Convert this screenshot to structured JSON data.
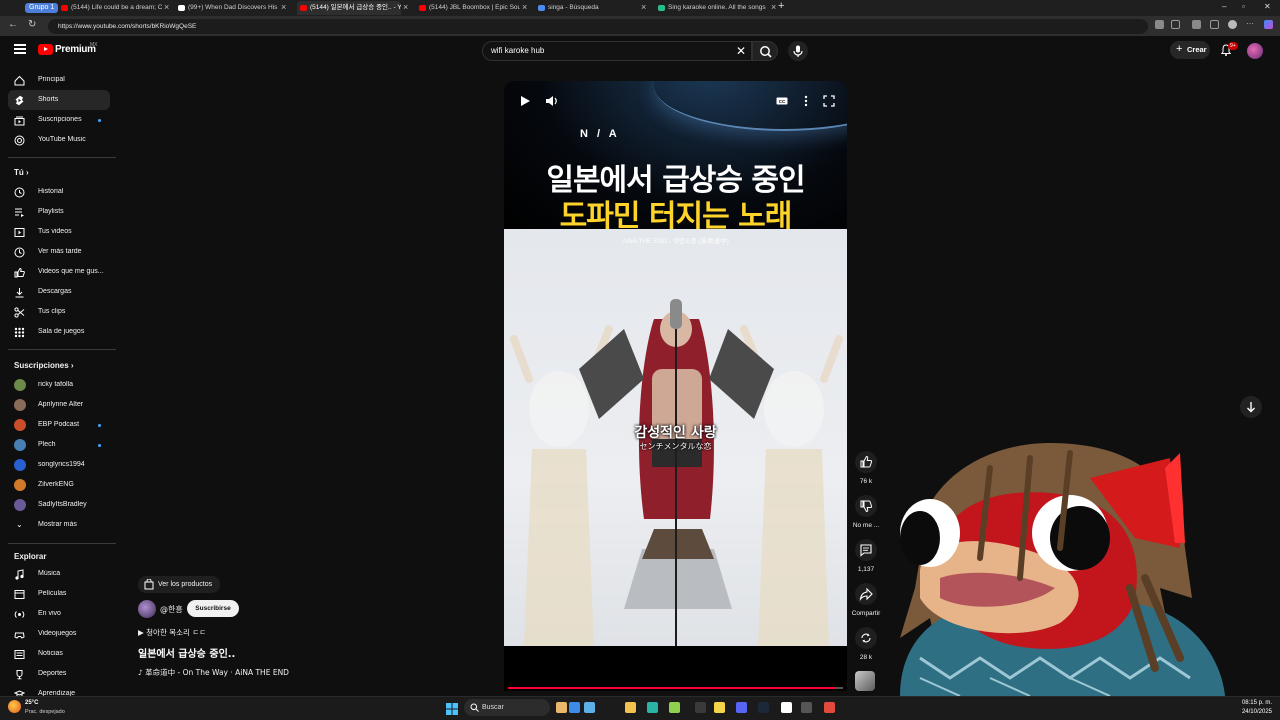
{
  "browser": {
    "tab_group": "Grupo 1",
    "tabs": [
      {
        "label": "(5144) Life could be a dream; Cas",
        "favicon_color": "#ff0000"
      },
      {
        "label": "(99+) When Dad Discovers His Da",
        "favicon_color": "#ffffff"
      },
      {
        "label": "(5144) 일본에서 급상승 중인.. - Yo",
        "favicon_color": "#ff0000",
        "active": true
      },
      {
        "label": "(5144) JBL Boombox | Epic Sound",
        "favicon_color": "#ff0000"
      },
      {
        "label": "singa - Búsqueda",
        "favicon_color": "#4b8bf5"
      },
      {
        "label": "Sing karaoke online. All the songs",
        "favicon_color": "#27c08a"
      }
    ],
    "url": "https://www.youtube.com/shorts/bKRioWgQeSE"
  },
  "topbar": {
    "logo_text": "Premium",
    "country": "MX",
    "search_value": "wifi karoke hub",
    "create_label": "Crear",
    "notif_badge": "9+"
  },
  "sidebar": {
    "main": [
      {
        "label": "Principal",
        "icon": "home-icon"
      },
      {
        "label": "Shorts",
        "icon": "shorts-icon",
        "active": true
      },
      {
        "label": "Suscripciones",
        "icon": "subscriptions-icon",
        "dot": true
      },
      {
        "label": "YouTube Music",
        "icon": "music-icon"
      }
    ],
    "you_heading": "Tú",
    "you": [
      {
        "label": "Historial",
        "icon": "history-icon"
      },
      {
        "label": "Playlists",
        "icon": "playlists-icon"
      },
      {
        "label": "Tus videos",
        "icon": "your-videos-icon"
      },
      {
        "label": "Ver más tarde",
        "icon": "watch-later-icon"
      },
      {
        "label": "Videos que me gus...",
        "icon": "liked-icon"
      },
      {
        "label": "Descargas",
        "icon": "download-icon"
      },
      {
        "label": "Tus clips",
        "icon": "clips-icon"
      },
      {
        "label": "Sala de juegos",
        "icon": "games-icon"
      }
    ],
    "subs_heading": "Suscripciones",
    "subs": [
      {
        "label": "ricky tafolla",
        "color": "#6c8a4a"
      },
      {
        "label": "Aprilynne Alter",
        "color": "#8b6b5a"
      },
      {
        "label": "EBP Podcast",
        "color": "#c94f2a",
        "dot": true
      },
      {
        "label": "Plech",
        "color": "#4a7fb5",
        "dot": true
      },
      {
        "label": "songlyrics1994",
        "color": "#2a5fd0"
      },
      {
        "label": "ZilverkENG",
        "color": "#d07a2a"
      },
      {
        "label": "SadlyItsBradley",
        "color": "#6a5a9a"
      },
      {
        "label": "Mostrar más",
        "chevron": true
      }
    ],
    "explore_heading": "Explorar",
    "explore": [
      {
        "label": "Música",
        "icon": "music-note-icon"
      },
      {
        "label": "Películas",
        "icon": "movies-icon"
      },
      {
        "label": "En vivo",
        "icon": "live-icon"
      },
      {
        "label": "Videojuegos",
        "icon": "gaming-icon"
      },
      {
        "label": "Noticias",
        "icon": "news-icon"
      },
      {
        "label": "Deportes",
        "icon": "sports-icon"
      },
      {
        "label": "Aprendizaje",
        "icon": "learning-icon"
      }
    ]
  },
  "short": {
    "na_label": "N / A",
    "headline_line1": "일본에서 급상승 중인",
    "headline_line2": "도파민 터지는 노래",
    "scene_caption": "AiNA THE END - 혁명도중 (革命道中)",
    "subtitle_kr": "감성적인 사랑",
    "subtitle_jp": "センチメンタルな恋",
    "progress": 0.98,
    "products_label": "Ver los productos",
    "channel": "@한흥",
    "subscribe_label": "Suscribirse",
    "song_sub": "▶ 청아한 목소리 ㄷㄷ",
    "title": "일본에서 급상승 중인..",
    "music": "♪ 革命道中 - On The Way · AiNA THE END"
  },
  "actions": {
    "likes": "76 k",
    "dislike": "No me ...",
    "comments": "1,137",
    "share": "Compartir",
    "remix": "28 k"
  },
  "taskbar": {
    "temp": "25°C",
    "weather": "Prac. despejado",
    "search": "Buscar",
    "time": "08:15 p. m.",
    "date": "24/10/2025"
  }
}
